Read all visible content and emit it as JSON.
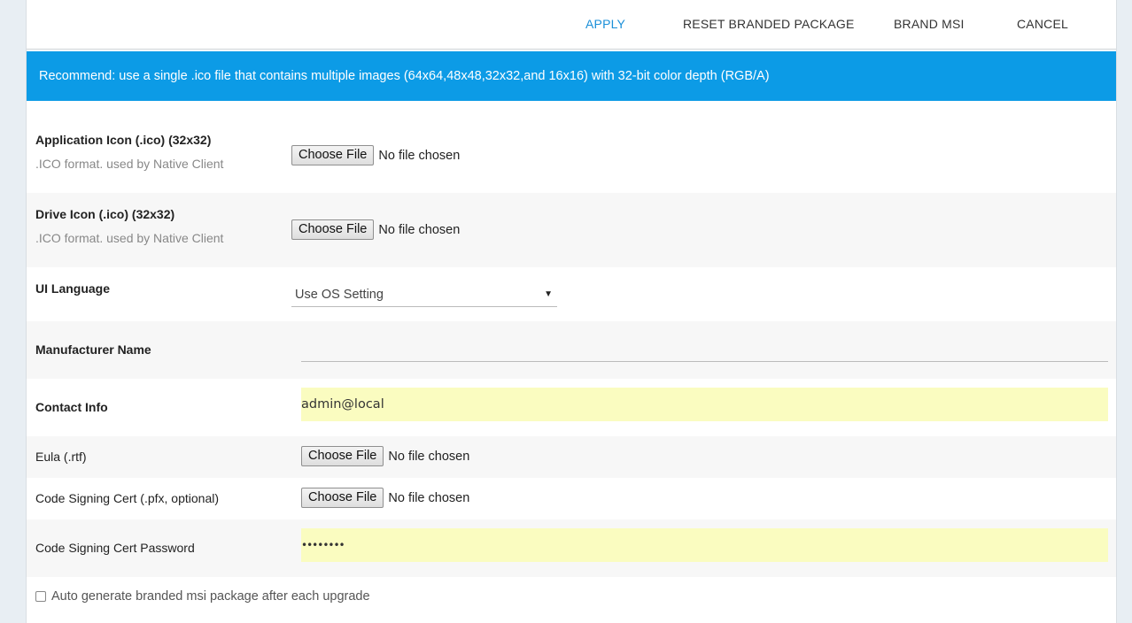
{
  "toolbar": {
    "apply": "APPLY",
    "reset": "RESET BRANDED PACKAGE",
    "brand_msi": "BRAND MSI",
    "cancel": "CANCEL"
  },
  "banner": {
    "text": "Recommend: use a single .ico file that contains multiple images (64x64,48x48,32x32,and 16x16) with 32-bit color depth (RGB/A)"
  },
  "fields": {
    "app_icon": {
      "label": "Application Icon (.ico) (32x32)",
      "hint": ".ICO format. used by Native Client",
      "button": "Choose File",
      "status": "No file chosen"
    },
    "drive_icon": {
      "label": "Drive Icon (.ico) (32x32)",
      "hint": ".ICO format. used by Native Client",
      "button": "Choose File",
      "status": "No file chosen"
    },
    "ui_language": {
      "label": "UI Language",
      "value": "Use OS Setting"
    },
    "manufacturer": {
      "label": "Manufacturer Name",
      "value": ""
    },
    "contact": {
      "label": "Contact Info",
      "value": "admin@local"
    },
    "eula": {
      "label": "Eula (.rtf)",
      "button": "Choose File",
      "status": "No file chosen"
    },
    "cert": {
      "label": "Code Signing Cert (.pfx, optional)",
      "button": "Choose File",
      "status": "No file chosen"
    },
    "cert_password": {
      "label": "Code Signing Cert Password",
      "value": "••••••••"
    }
  },
  "auto_generate": {
    "label": "Auto generate branded msi package after each upgrade",
    "checked": false
  },
  "colors": {
    "accent": "#1a8fd8",
    "banner": "#0c9be6",
    "autofill": "#fafcc0"
  }
}
